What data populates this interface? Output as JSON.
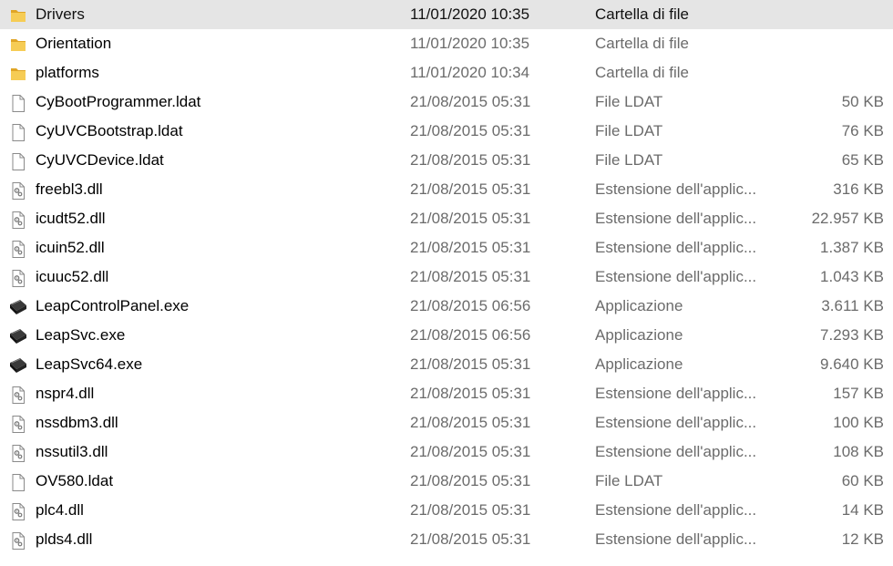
{
  "colors": {
    "selection": "#e5e5e5",
    "folder": "#f2c54b",
    "muted_text": "#6b6b6b"
  },
  "files": [
    {
      "name": "Drivers",
      "date": "11/01/2020 10:35",
      "type": "Cartella di file",
      "size": "",
      "icon": "folder-icon",
      "selected": true
    },
    {
      "name": "Orientation",
      "date": "11/01/2020 10:35",
      "type": "Cartella di file",
      "size": "",
      "icon": "folder-icon"
    },
    {
      "name": "platforms",
      "date": "11/01/2020 10:34",
      "type": "Cartella di file",
      "size": "",
      "icon": "folder-icon"
    },
    {
      "name": "CyBootProgrammer.ldat",
      "date": "21/08/2015 05:31",
      "type": "File LDAT",
      "size": "50 KB",
      "icon": "blank-file-icon"
    },
    {
      "name": "CyUVCBootstrap.ldat",
      "date": "21/08/2015 05:31",
      "type": "File LDAT",
      "size": "76 KB",
      "icon": "blank-file-icon"
    },
    {
      "name": "CyUVCDevice.ldat",
      "date": "21/08/2015 05:31",
      "type": "File LDAT",
      "size": "65 KB",
      "icon": "blank-file-icon"
    },
    {
      "name": "freebl3.dll",
      "date": "21/08/2015 05:31",
      "type": "Estensione dell'applic...",
      "size": "316 KB",
      "icon": "dll-file-icon"
    },
    {
      "name": "icudt52.dll",
      "date": "21/08/2015 05:31",
      "type": "Estensione dell'applic...",
      "size": "22.957 KB",
      "icon": "dll-file-icon"
    },
    {
      "name": "icuin52.dll",
      "date": "21/08/2015 05:31",
      "type": "Estensione dell'applic...",
      "size": "1.387 KB",
      "icon": "dll-file-icon"
    },
    {
      "name": "icuuc52.dll",
      "date": "21/08/2015 05:31",
      "type": "Estensione dell'applic...",
      "size": "1.043 KB",
      "icon": "dll-file-icon"
    },
    {
      "name": "LeapControlPanel.exe",
      "date": "21/08/2015 06:56",
      "type": "Applicazione",
      "size": "3.611 KB",
      "icon": "leap-device-icon"
    },
    {
      "name": "LeapSvc.exe",
      "date": "21/08/2015 06:56",
      "type": "Applicazione",
      "size": "7.293 KB",
      "icon": "leap-device-icon"
    },
    {
      "name": "LeapSvc64.exe",
      "date": "21/08/2015 05:31",
      "type": "Applicazione",
      "size": "9.640 KB",
      "icon": "leap-device-icon"
    },
    {
      "name": "nspr4.dll",
      "date": "21/08/2015 05:31",
      "type": "Estensione dell'applic...",
      "size": "157 KB",
      "icon": "dll-file-icon"
    },
    {
      "name": "nssdbm3.dll",
      "date": "21/08/2015 05:31",
      "type": "Estensione dell'applic...",
      "size": "100 KB",
      "icon": "dll-file-icon"
    },
    {
      "name": "nssutil3.dll",
      "date": "21/08/2015 05:31",
      "type": "Estensione dell'applic...",
      "size": "108 KB",
      "icon": "dll-file-icon"
    },
    {
      "name": "OV580.ldat",
      "date": "21/08/2015 05:31",
      "type": "File LDAT",
      "size": "60 KB",
      "icon": "blank-file-icon"
    },
    {
      "name": "plc4.dll",
      "date": "21/08/2015 05:31",
      "type": "Estensione dell'applic...",
      "size": "14 KB",
      "icon": "dll-file-icon"
    },
    {
      "name": "plds4.dll",
      "date": "21/08/2015 05:31",
      "type": "Estensione dell'applic...",
      "size": "12 KB",
      "icon": "dll-file-icon"
    }
  ]
}
